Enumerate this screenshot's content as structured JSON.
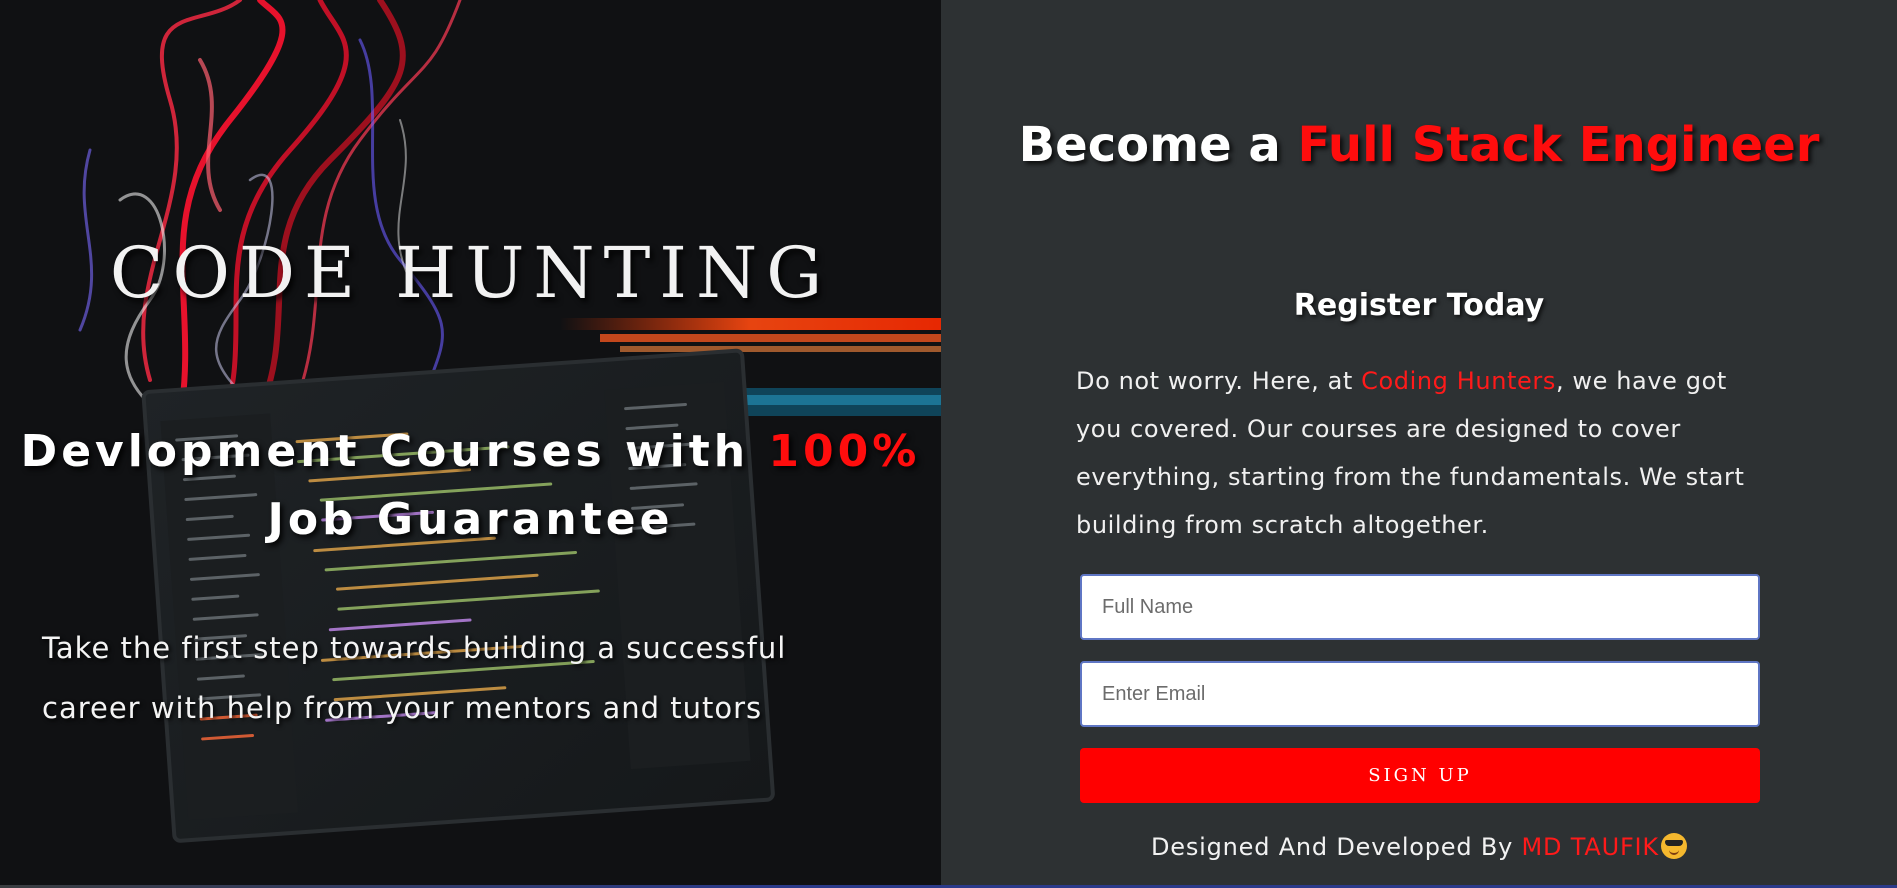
{
  "hero": {
    "brand": "CODE HUNTING",
    "tagline_main": "Devlopment Courses with",
    "tagline_accent": "100%",
    "tagline_tail": "Job Guarantee",
    "subtitle": "Take the first step towards building a successful career with help from your mentors and tutors"
  },
  "form_panel": {
    "headline_prefix": "Become a",
    "headline_accent": "Full Stack Engineer",
    "register": "Register Today",
    "intro_before": "Do not worry. Here, at",
    "intro_accent": "Coding Hunters",
    "intro_after": ", we have got you covered. Our courses are designed to cover everything, starting from the fundamentals. We start building from scratch altogether.",
    "name_placeholder": "Full Name",
    "email_placeholder": "Enter Email",
    "signup_label": "SIGN UP",
    "footer_prefix": "Designed And Developed By",
    "footer_accent": "MD TAUFIK",
    "footer_emoji": "smiling-face-with-sunglasses-icon"
  },
  "colors": {
    "accent": "#ff0d0d",
    "panel_bg": "#2d3133",
    "hero_bg": "#111214",
    "input_border": "#5f76c4",
    "button_bg": "#ff0000"
  }
}
